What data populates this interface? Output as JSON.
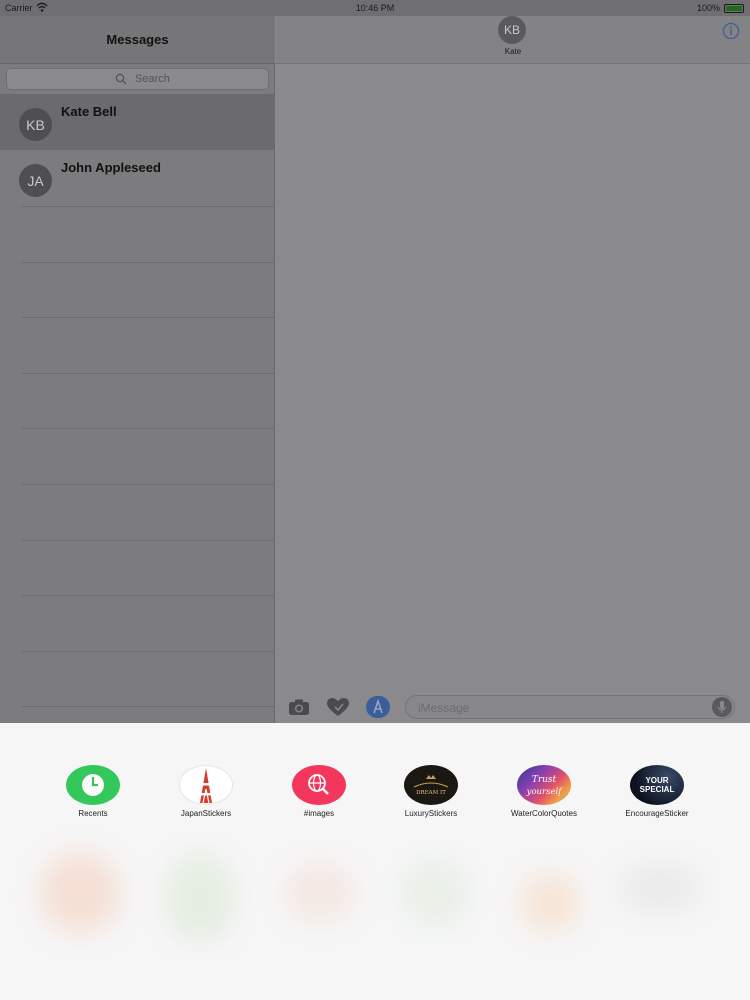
{
  "status_bar": {
    "carrier": "Carrier",
    "time": "10:46 PM",
    "battery": "100%",
    "battery_level": 1.0
  },
  "sidebar": {
    "title": "Messages",
    "search_placeholder": "Search",
    "conversations": [
      {
        "initials": "KB",
        "name": "Kate Bell",
        "selected": true
      },
      {
        "initials": "JA",
        "name": "John Appleseed",
        "selected": false
      }
    ]
  },
  "conversation": {
    "contact_initials": "KB",
    "contact_name": "Kate",
    "message_placeholder": "iMessage"
  },
  "app_drawer": {
    "apps": [
      {
        "label": "Recents",
        "icon": "clock-icon"
      },
      {
        "label": "JapanStickers",
        "icon": "tokyo-tower-icon"
      },
      {
        "label": "#images",
        "icon": "globe-search-icon"
      },
      {
        "label": "LuxuryStickers",
        "icon": "luxury-badge-icon"
      },
      {
        "label": "WaterColorQuotes",
        "icon": "watercolor-quote-icon"
      },
      {
        "label": "EncourageSticker",
        "icon": "your-special-icon"
      }
    ],
    "icon_texts": {
      "luxury": "DREAM IT",
      "watercolor_1": "Trust",
      "watercolor_2": "yourself",
      "encourage_1": "YOUR",
      "encourage_2": "SPECIAL"
    }
  },
  "colors": {
    "recents_green": "#34c759",
    "images_pink": "#f2365c",
    "link_blue": "#3b6fd4"
  }
}
